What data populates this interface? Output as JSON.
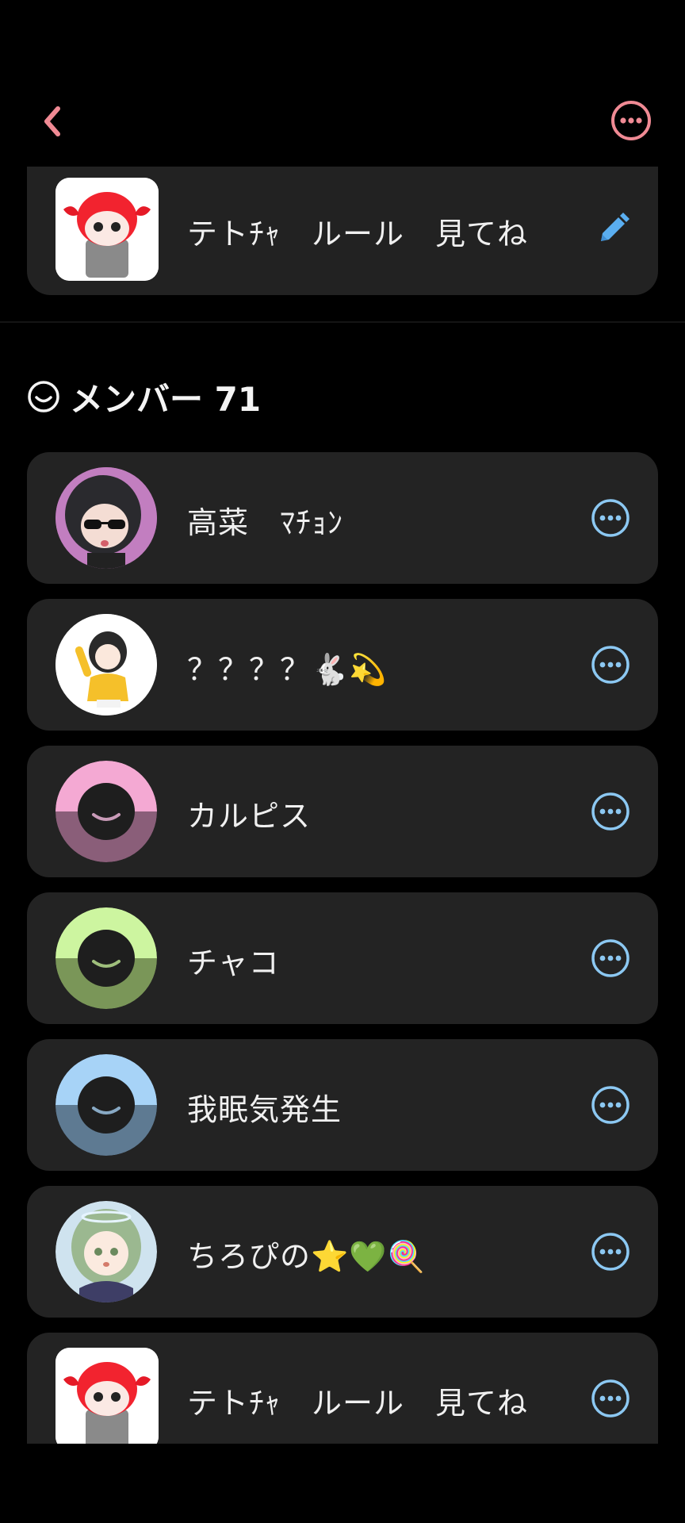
{
  "header": {
    "back_icon": "chevron-left-icon",
    "menu_icon": "more-horizontal-icon",
    "accent": "#f08a94"
  },
  "pinned": {
    "name": "テトﾁｬ　ルール　見てね",
    "edit_icon": "pencil-icon",
    "edit_color": "#5aaef0"
  },
  "members": {
    "title": "メンバー 71",
    "icon": "smile-face-icon",
    "more_color": "#8cc8f2",
    "items": [
      {
        "name": "高菜　ﾏﾁｮﾝ",
        "avatar": "anime-girl-sunglasses"
      },
      {
        "name": "？？？？🐇💫",
        "avatar": "anime-girl-yellow"
      },
      {
        "name": "カルピス",
        "avatar": "default-pink",
        "color": "#f4a9d3"
      },
      {
        "name": "チャコ",
        "avatar": "default-green",
        "color": "#cdf5a0"
      },
      {
        "name": "我眠気発生",
        "avatar": "default-blue",
        "color": "#a7d3f7"
      },
      {
        "name": "ちろぴの⭐💚🍭",
        "avatar": "anime-girl-green-hair"
      },
      {
        "name": "テトﾁｬ　ルール　見てね",
        "avatar": "teto-sign"
      }
    ]
  }
}
